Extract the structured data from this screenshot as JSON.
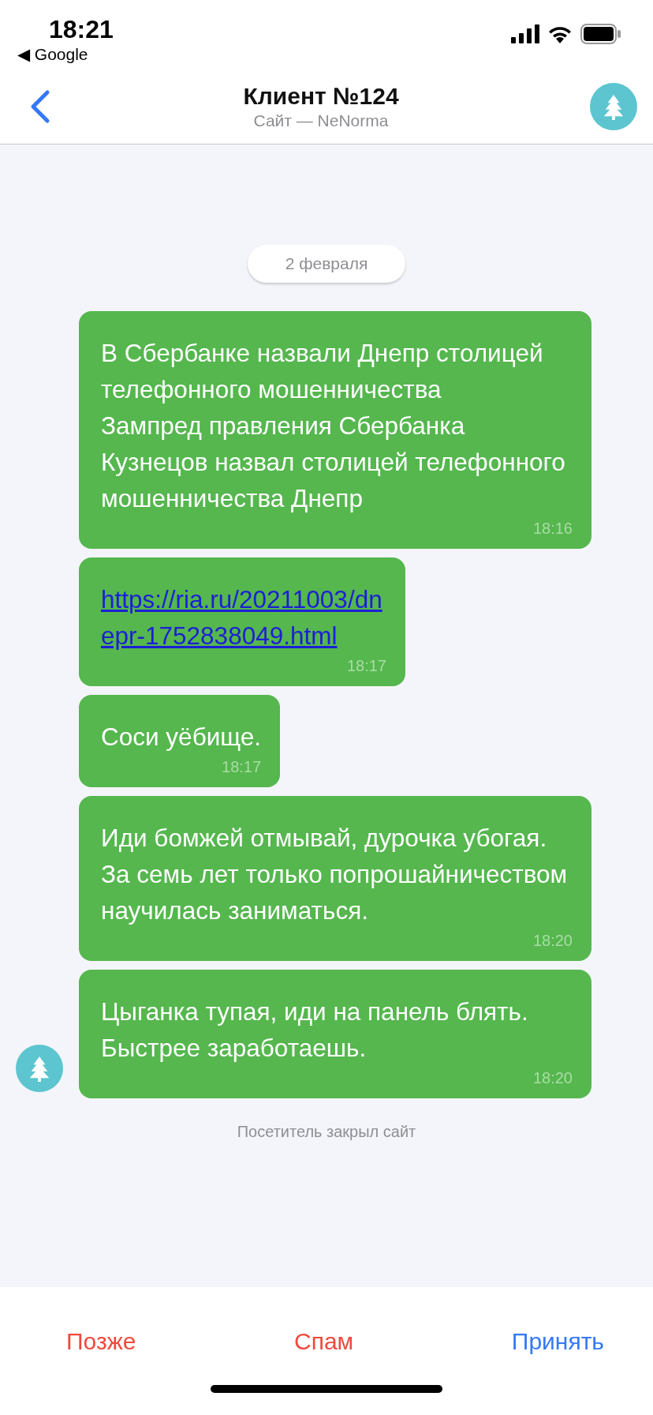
{
  "status_bar": {
    "time": "18:21",
    "back_app": "◀ Google"
  },
  "header": {
    "title": "Клиент №124",
    "subtitle": "Сайт — NeNorma"
  },
  "chat": {
    "date": "2 февраля",
    "messages": [
      {
        "kind": "text",
        "text": "В Сбербанке назвали Днепр столицей телефонного мошенничества\nЗампред правления Сбербанка Кузнецов назвал столицей телефонного мошенничества Днепр",
        "time": "18:16",
        "avatar": false
      },
      {
        "kind": "link",
        "text": "https://ria.ru/20211003/dnepr-1752838049.html",
        "time": "18:17",
        "avatar": false
      },
      {
        "kind": "text",
        "text": "Соси уёбище.",
        "time": "18:17",
        "avatar": false
      },
      {
        "kind": "text",
        "text": "Иди бомжей отмывай, дурочка убогая. За семь лет только попрошайничеством научилась заниматься.",
        "time": "18:20",
        "avatar": false
      },
      {
        "kind": "text",
        "text": "Цыганка тупая, иди на панель блять. Быстрее заработаешь.",
        "time": "18:20",
        "avatar": true
      }
    ],
    "notice": "Посетитель закрыл сайт"
  },
  "actions": [
    {
      "label": "Позже",
      "kind": "destructive"
    },
    {
      "label": "Спам",
      "kind": "destructive"
    },
    {
      "label": "Принять",
      "kind": "primary"
    }
  ]
}
